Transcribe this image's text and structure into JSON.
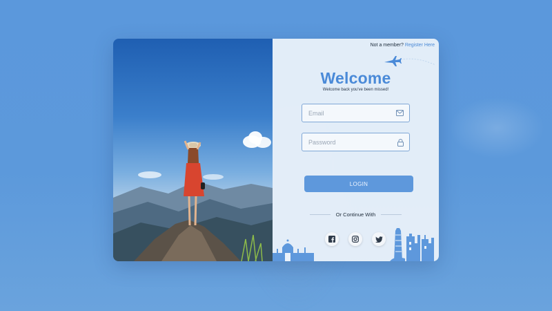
{
  "auth": {
    "register_prompt": "Not a member?",
    "register_link": "Register Here",
    "title": "Welcome",
    "subtitle": "Welcome back you've been missed!",
    "email_placeholder": "Email",
    "password_placeholder": "Password",
    "login_label": "LOGIN",
    "continue_label": "Or Continue With"
  },
  "icons": {
    "email": "mail-icon",
    "password": "lock-icon",
    "plane": "airplane-icon",
    "socials": [
      "facebook-icon",
      "instagram-icon",
      "twitter-icon"
    ]
  },
  "colors": {
    "accent": "#4a8ad8",
    "button": "#5e98dc",
    "background": "#5b98dc",
    "panel": "#ebf2fa"
  }
}
